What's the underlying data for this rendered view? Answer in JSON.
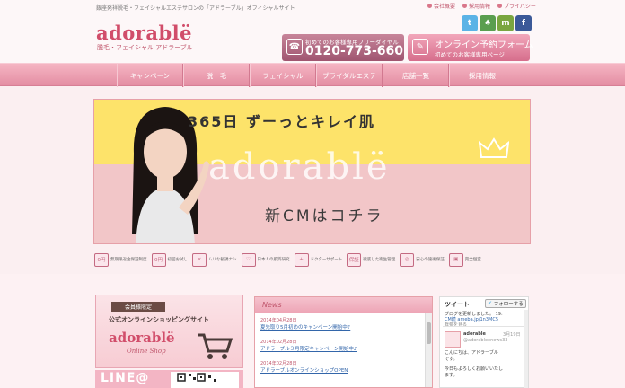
{
  "header": {
    "tagline": "銀座発祥脱毛・フェイシャルエステサロンの「アドラーブル」オフィシャルサイト",
    "top_links": [
      "会社概要",
      "採用情報",
      "プライバシー"
    ],
    "logo": "adorablё",
    "logo_sub": "脱毛・フェイシャル アドラーブル",
    "social": [
      {
        "icon": "twitter-icon",
        "label": "t",
        "color": "#5bb3e6"
      },
      {
        "icon": "ameba-icon",
        "label": "♠",
        "color": "#5a9e4f"
      },
      {
        "icon": "mixi-icon",
        "label": "m",
        "color": "#7aa640"
      },
      {
        "icon": "facebook-icon",
        "label": "f",
        "color": "#3b5998"
      }
    ],
    "phone_cta": {
      "caption": "初めてのお客様専用フリーダイヤル",
      "number": "0120-773-660"
    },
    "web_cta": {
      "title": "オンライン予約フォーム",
      "caption": "初めてのお客様専用ページ"
    }
  },
  "nav": [
    "キャンペーン",
    "脱　毛",
    "フェイシャル",
    "ブライダルエステ",
    "店舗一覧",
    "採用情報"
  ],
  "hero": {
    "headline": "365日 ずーっとキレイ肌",
    "brand": "adorablё",
    "subline": "新CMはコチラ"
  },
  "features": [
    {
      "icon": "0円",
      "label": "無期限返金保証制度"
    },
    {
      "icon": "0円",
      "label": "初回お試し"
    },
    {
      "icon": "×",
      "label": "ムリな勧誘ナシ"
    },
    {
      "icon": "♡",
      "label": "日本人の肌質研究"
    },
    {
      "icon": "+",
      "label": "ドクターサポート"
    },
    {
      "icon": "保証",
      "label": "徹底した衛生管理"
    },
    {
      "icon": "◎",
      "label": "安心の施術保証"
    },
    {
      "icon": "▣",
      "label": "完全個室"
    }
  ],
  "shop": {
    "badge": "会員様限定",
    "title": "公式オンラインショッピングサイト",
    "logo": "adorablё",
    "logo_sub": "Online Shop"
  },
  "line": {
    "label": "LINE@"
  },
  "news": {
    "heading": "News",
    "items": [
      {
        "date": "2014年04月28日",
        "title": "夏先取り5月初めのキャンペーン開始中♪"
      },
      {
        "date": "2014年02月28日",
        "title": "アドラーブル３月限定キャンペーン開始中♪"
      },
      {
        "date": "2014年02月28日",
        "title": "アドラーブルオンラインショップOPEN"
      }
    ]
  },
  "twitter": {
    "heading": "ツイート",
    "follow": "フォローする",
    "lines": [
      "ブログを更新しました。 19:",
      "CM続 ameba.jp/1n3MC5",
      "概要を見る"
    ],
    "user": "adorable",
    "time": "3月19日",
    "handle": "@adorableenews33",
    "tweet": [
      "こんにちは、アドラーブル",
      "です。",
      "今日もよろしくお願いいたし",
      "ます。"
    ]
  }
}
